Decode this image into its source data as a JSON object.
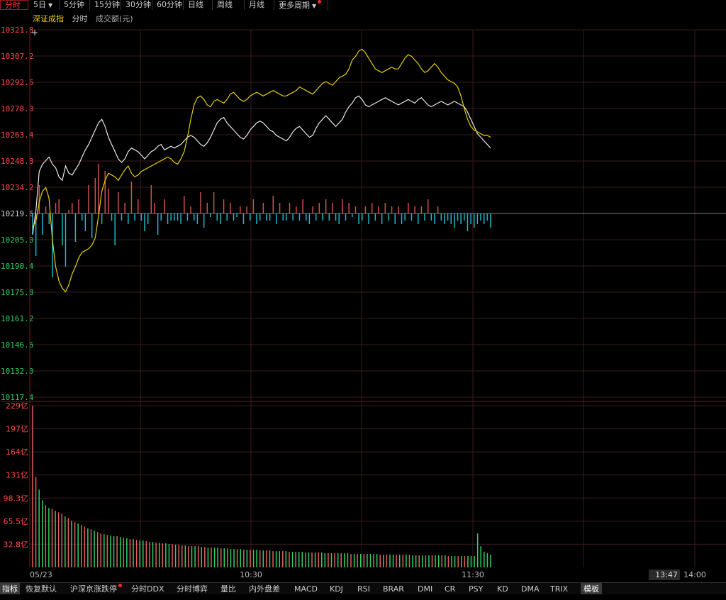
{
  "toolbar": {
    "tabs": [
      {
        "label": "分时",
        "active": true,
        "dropdown": false,
        "dot": false
      },
      {
        "label": "5日",
        "active": false,
        "dropdown": true,
        "dot": false
      },
      {
        "label": "5分钟",
        "active": false,
        "dropdown": false,
        "dot": false
      },
      {
        "label": "15分钟",
        "active": false,
        "dropdown": false,
        "dot": false
      },
      {
        "label": "30分钟",
        "active": false,
        "dropdown": false,
        "dot": false
      },
      {
        "label": "60分钟",
        "active": false,
        "dropdown": false,
        "dot": false
      },
      {
        "label": "日线",
        "active": false,
        "dropdown": false,
        "dot": false
      },
      {
        "label": "周线",
        "active": false,
        "dropdown": false,
        "dot": false
      },
      {
        "label": "月线",
        "active": false,
        "dropdown": false,
        "dot": false
      },
      {
        "label": "更多周期",
        "active": false,
        "dropdown": true,
        "dot": true
      }
    ]
  },
  "subheader": {
    "index_name": "深证成指",
    "mode": "分时",
    "volume_label": "成交额(元)"
  },
  "colors": {
    "up": "#ff4040",
    "down": "#00c8c8",
    "grid": "#2a1414",
    "price": "#e8e8e8",
    "avg": "#e6d000",
    "vol_up": "#e06060",
    "vol_down": "#30d060"
  },
  "chart_data": [
    {
      "type": "line",
      "title": "深证成指 分时",
      "prev_close": 10219.6,
      "y_ticks": [
        "10321.8",
        "10307.2",
        "10292.6",
        "10278.0",
        "10263.4",
        "10248.8",
        "10234.2",
        "10219.6",
        "10205.0",
        "10190.4",
        "10175.8",
        "10161.2",
        "10146.6",
        "10132.0",
        "10117.4"
      ],
      "x_labels": [
        "05/23",
        "10:30",
        "11:30",
        "13:47",
        "14:00"
      ],
      "series": [
        {
          "name": "价格",
          "values": [
            10208,
            10221,
            10243,
            10247,
            10249,
            10251,
            10247,
            10245,
            10240,
            10238,
            10246,
            10242,
            10241,
            10244,
            10247,
            10251,
            10255,
            10258,
            10262,
            10266,
            10270,
            10272,
            10268,
            10262,
            10258,
            10254,
            10250,
            10248,
            10250,
            10254,
            10256,
            10255,
            10254,
            10252,
            10250,
            10252,
            10254,
            10255,
            10257,
            10258,
            10255,
            10256,
            10257,
            10256,
            10257,
            10258,
            10260,
            10262,
            10263,
            10262,
            10260,
            10258,
            10257,
            10259,
            10262,
            10266,
            10270,
            10272,
            10273,
            10270,
            10268,
            10266,
            10264,
            10262,
            10261,
            10263,
            10266,
            10268,
            10270,
            10271,
            10270,
            10268,
            10266,
            10265,
            10263,
            10262,
            10261,
            10260,
            10262,
            10265,
            10267,
            10268,
            10266,
            10264,
            10262,
            10263,
            10267,
            10270,
            10272,
            10274,
            10272,
            10270,
            10268,
            10270,
            10272,
            10276,
            10279,
            10281,
            10284,
            10285,
            10283,
            10280,
            10279,
            10280,
            10281,
            10282,
            10283,
            10284,
            10283,
            10282,
            10281,
            10280,
            10281,
            10282,
            10283,
            10282,
            10281,
            10283,
            10284,
            10282,
            10280,
            10279,
            10280,
            10281,
            10282,
            10281,
            10280,
            10281,
            10282,
            10281,
            10280,
            10279,
            10276,
            10272,
            10268,
            10264,
            10262,
            10260,
            10258,
            10256
          ]
        },
        {
          "name": "均价",
          "values": [
            10212,
            10215,
            10226,
            10232,
            10234,
            10228,
            10205,
            10190,
            10182,
            10178,
            10176,
            10180,
            10186,
            10190,
            10195,
            10198,
            10199,
            10200,
            10202,
            10206,
            10218,
            10232,
            10238,
            10242,
            10241,
            10240,
            10238,
            10241,
            10244,
            10246,
            10242,
            10240,
            10241,
            10243,
            10244,
            10245,
            10246,
            10247,
            10248,
            10249,
            10250,
            10251,
            10250,
            10248,
            10247,
            10250,
            10254,
            10262,
            10272,
            10280,
            10284,
            10285,
            10283,
            10280,
            10279,
            10282,
            10283,
            10282,
            10281,
            10283,
            10286,
            10287,
            10285,
            10283,
            10282,
            10283,
            10285,
            10286,
            10287,
            10286,
            10285,
            10286,
            10287,
            10288,
            10287,
            10286,
            10285,
            10285,
            10286,
            10287,
            10288,
            10290,
            10289,
            10288,
            10287,
            10286,
            10288,
            10290,
            10292,
            10293,
            10292,
            10291,
            10293,
            10295,
            10296,
            10297,
            10300,
            10305,
            10307,
            10310,
            10311,
            10309,
            10306,
            10303,
            10300,
            10299,
            10298,
            10299,
            10300,
            10301,
            10300,
            10300,
            10303,
            10306,
            10308,
            10307,
            10305,
            10303,
            10300,
            10298,
            10299,
            10301,
            10303,
            10301,
            10298,
            10296,
            10294,
            10293,
            10292,
            10290,
            10285,
            10278,
            10272,
            10268,
            10266,
            10265,
            10264,
            10263,
            10263,
            10262
          ]
        }
      ],
      "ticks_volume": [
        -6,
        -12,
        8,
        -6,
        2,
        -3,
        -18,
        3,
        4,
        -9,
        -15,
        1,
        3,
        -8,
        4,
        -2,
        -5,
        8,
        -7,
        10,
        14,
        -3,
        12,
        7,
        -2,
        -9,
        6,
        -2,
        3,
        -3,
        9,
        -2,
        4,
        -2,
        -5,
        -3,
        8,
        3,
        -6,
        -2,
        4,
        -3,
        -2,
        -2,
        -2,
        -3,
        5,
        -2,
        2,
        -2,
        -3,
        6,
        -4,
        3,
        -1,
        6,
        -2,
        -3,
        4,
        -2,
        3,
        -2,
        -1,
        2,
        -3,
        2,
        -2,
        4,
        -3,
        -2,
        3,
        -2,
        -2,
        5,
        -3,
        3,
        -2,
        -2,
        3,
        -2,
        2,
        -2,
        4,
        -2,
        -3,
        2,
        -2,
        3,
        -2,
        4,
        -2,
        3,
        -2,
        -3,
        4,
        -2,
        3,
        -1,
        2,
        -3,
        -2,
        2,
        -3,
        3,
        -2,
        2,
        -3,
        3,
        -2,
        2,
        -3,
        2,
        -3,
        -2,
        3,
        -2,
        2,
        -3,
        2,
        -2,
        4,
        -2,
        -3,
        2,
        -2,
        -3,
        -2,
        -3,
        -4,
        -2,
        -3,
        -2,
        -5,
        -3,
        -4,
        -3,
        -2,
        -3,
        -2,
        -4
      ],
      "ylim": [
        10117.4,
        10321.8
      ]
    },
    {
      "type": "bar",
      "title": "成交额",
      "y_ticks": [
        "229亿",
        "197亿",
        "164亿",
        "131亿",
        "98.3亿",
        "65.5亿",
        "32.8亿"
      ],
      "ylim": [
        0,
        229
      ],
      "values": [
        229,
        128,
        110,
        95,
        88,
        84,
        83,
        80,
        78,
        76,
        72,
        70,
        66,
        64,
        62,
        60,
        58,
        55,
        54,
        52,
        50,
        48,
        47,
        46,
        45,
        44,
        44,
        43,
        42,
        41,
        40,
        40,
        39,
        38,
        38,
        37,
        36,
        36,
        35,
        35,
        34,
        34,
        33,
        33,
        32,
        32,
        31,
        31,
        30,
        30,
        30,
        30,
        29,
        29,
        28,
        28,
        28,
        28,
        27,
        27,
        27,
        26,
        26,
        26,
        26,
        25,
        25,
        25,
        25,
        25,
        24,
        24,
        24,
        24,
        23,
        23,
        23,
        23,
        23,
        22,
        22,
        22,
        22,
        22,
        21,
        21,
        21,
        21,
        21,
        21,
        20,
        20,
        20,
        20,
        20,
        20,
        20,
        20,
        19,
        19,
        19,
        19,
        19,
        19,
        19,
        19,
        19,
        18,
        18,
        18,
        18,
        18,
        18,
        18,
        18,
        18,
        18,
        17,
        17,
        17,
        17,
        17,
        17,
        17,
        17,
        17,
        17,
        17,
        16,
        16,
        16,
        16,
        16,
        16,
        16,
        16,
        16,
        48,
        30,
        22,
        20,
        18
      ],
      "up": [
        1,
        1,
        0,
        0,
        1,
        0,
        1,
        0,
        1,
        1,
        0,
        1,
        0,
        1,
        0,
        1,
        1,
        0,
        1,
        0,
        1,
        1,
        0,
        1,
        0,
        0,
        1,
        0,
        1,
        0,
        1,
        0,
        1,
        0,
        0,
        1,
        1,
        0,
        1,
        0,
        1,
        0,
        0,
        1,
        0,
        1,
        1,
        0,
        1,
        0,
        0,
        1,
        0,
        1,
        0,
        1,
        0,
        0,
        1,
        0,
        1,
        0,
        0,
        1,
        0,
        1,
        0,
        1,
        0,
        0,
        1,
        0,
        1,
        0,
        1,
        0,
        0,
        1,
        0,
        1,
        0,
        1,
        0,
        0,
        1,
        0,
        1,
        0,
        1,
        0,
        0,
        1,
        0,
        1,
        0,
        1,
        0,
        0,
        1,
        0,
        1,
        0,
        1,
        0,
        0,
        1,
        0,
        1,
        0,
        1,
        0,
        0,
        1,
        0,
        1,
        0,
        1,
        0,
        0,
        1,
        0,
        1,
        0,
        1,
        0,
        0,
        1,
        0,
        1,
        0,
        0,
        1,
        0,
        1,
        0,
        0,
        0,
        0,
        0,
        0,
        0
      ]
    }
  ],
  "bottombar": {
    "items": [
      {
        "label": "指标",
        "active": true,
        "dot": false
      },
      {
        "label": "恢复默认",
        "active": false,
        "dot": false
      },
      {
        "label": "沪深京涨跌停",
        "active": false,
        "dot": true
      },
      {
        "label": "分时DDX",
        "active": false,
        "dot": false
      },
      {
        "label": "分时博弈",
        "active": false,
        "dot": false
      },
      {
        "label": "量比",
        "active": false,
        "dot": false
      },
      {
        "label": "内外盘差",
        "active": false,
        "dot": false
      },
      {
        "label": "MACD",
        "active": false,
        "dot": false
      },
      {
        "label": "KDJ",
        "active": false,
        "dot": false
      },
      {
        "label": "RSI",
        "active": false,
        "dot": false
      },
      {
        "label": "BRAR",
        "active": false,
        "dot": false
      },
      {
        "label": "DMI",
        "active": false,
        "dot": false
      },
      {
        "label": "CR",
        "active": false,
        "dot": false
      },
      {
        "label": "PSY",
        "active": false,
        "dot": false
      },
      {
        "label": "KD",
        "active": false,
        "dot": false
      },
      {
        "label": "DMA",
        "active": false,
        "dot": false
      },
      {
        "label": "TRIX",
        "active": false,
        "dot": false
      },
      {
        "label": "模板",
        "active": true,
        "dot": false
      }
    ]
  }
}
